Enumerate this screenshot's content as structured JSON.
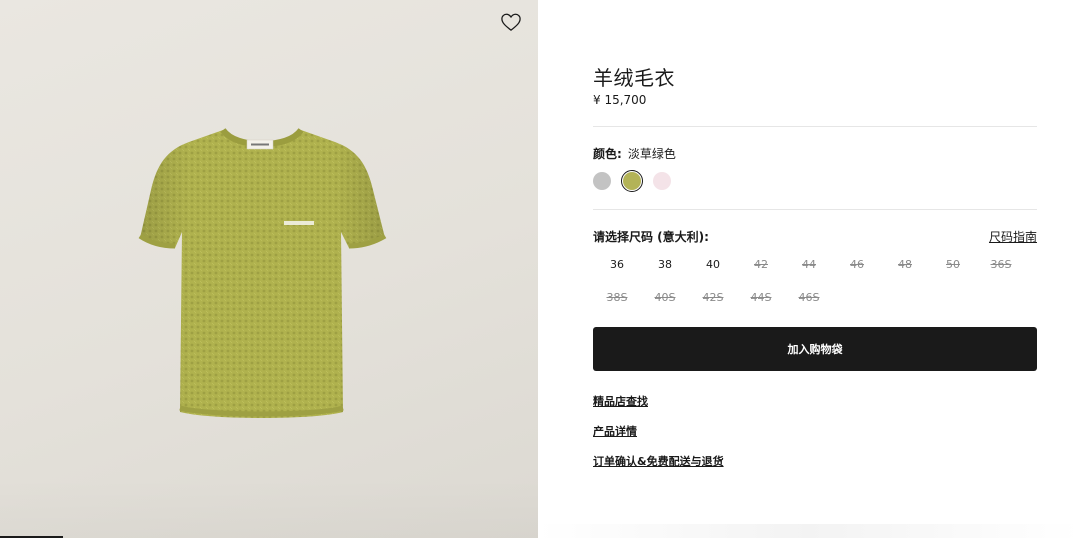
{
  "product": {
    "title": "羊绒毛衣",
    "price": "¥ 15,700"
  },
  "color": {
    "label": "颜色:",
    "selected_name": "淡草绿色",
    "swatches": [
      {
        "name": "gray",
        "hex": "#c3c3c3",
        "selected": false
      },
      {
        "name": "淡草绿色",
        "hex": "#b3b357",
        "selected": true
      },
      {
        "name": "pink",
        "hex": "#f4e3e8",
        "selected": false
      }
    ]
  },
  "size": {
    "label": "请选择尺码 (意大利):",
    "guide": "尺码指南",
    "options": [
      {
        "label": "36",
        "available": true
      },
      {
        "label": "38",
        "available": true
      },
      {
        "label": "40",
        "available": true
      },
      {
        "label": "42",
        "available": false
      },
      {
        "label": "44",
        "available": false
      },
      {
        "label": "46",
        "available": false
      },
      {
        "label": "48",
        "available": false
      },
      {
        "label": "50",
        "available": false
      },
      {
        "label": "36S",
        "available": false
      },
      {
        "label": "38S",
        "available": false
      },
      {
        "label": "40S",
        "available": false
      },
      {
        "label": "42S",
        "available": false
      },
      {
        "label": "44S",
        "available": false
      },
      {
        "label": "46S",
        "available": false
      }
    ]
  },
  "actions": {
    "add_to_bag": "加入购物袋"
  },
  "links": {
    "store_locator": "精品店查找",
    "product_details": "产品详情",
    "shipping_returns": "订单确认&免费配送与退货"
  },
  "icons": {
    "wishlist": "heart-icon"
  },
  "image": {
    "logo_text": "MIU MIU",
    "product_color": "#b0b24e"
  }
}
